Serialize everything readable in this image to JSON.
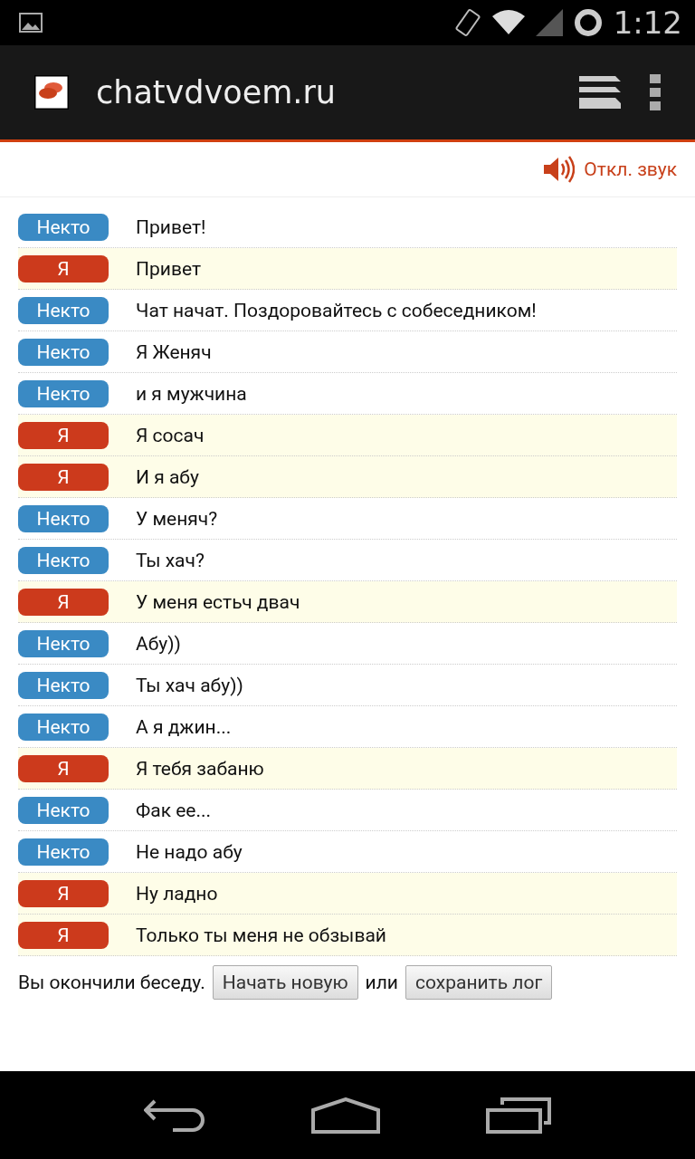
{
  "status_bar": {
    "time": "1:12"
  },
  "browser": {
    "title": "chatvdvoem.ru"
  },
  "sound": {
    "label": "Откл. звук"
  },
  "messages": [
    {
      "kind": "stranger",
      "sender": "Некто",
      "text": "Привет!"
    },
    {
      "kind": "me",
      "sender": "Я",
      "text": "Привет"
    },
    {
      "kind": "stranger",
      "sender": "Некто",
      "text": "Чат начат. Поздоровайтесь с собеседником!"
    },
    {
      "kind": "stranger",
      "sender": "Некто",
      "text": "Я Женяч"
    },
    {
      "kind": "stranger",
      "sender": "Некто",
      "text": "и я мужчина"
    },
    {
      "kind": "me",
      "sender": "Я",
      "text": "Я сосач"
    },
    {
      "kind": "me",
      "sender": "Я",
      "text": "И я абу"
    },
    {
      "kind": "stranger",
      "sender": "Некто",
      "text": "У меняч?"
    },
    {
      "kind": "stranger",
      "sender": "Некто",
      "text": "Ты хач?"
    },
    {
      "kind": "me",
      "sender": "Я",
      "text": "У меня естьч двач"
    },
    {
      "kind": "stranger",
      "sender": "Некто",
      "text": "Абу))"
    },
    {
      "kind": "stranger",
      "sender": "Некто",
      "text": "Ты хач абу))"
    },
    {
      "kind": "stranger",
      "sender": "Некто",
      "text": "А я джин..."
    },
    {
      "kind": "me",
      "sender": "Я",
      "text": "Я тебя забаню"
    },
    {
      "kind": "stranger",
      "sender": "Некто",
      "text": "Фак ее..."
    },
    {
      "kind": "stranger",
      "sender": "Некто",
      "text": "Не надо абу"
    },
    {
      "kind": "me",
      "sender": "Я",
      "text": "Ну ладно"
    },
    {
      "kind": "me",
      "sender": "Я",
      "text": "Только ты меня не обзывай"
    }
  ],
  "footer": {
    "text": "Вы окончили беседу.",
    "new_button": "Начать новую",
    "or": "или",
    "save_button": "сохранить лог"
  }
}
